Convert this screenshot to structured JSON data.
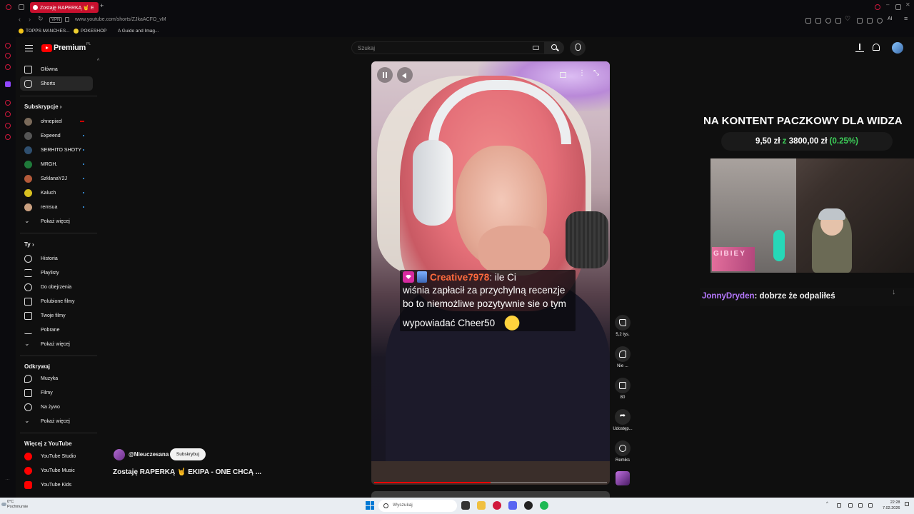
{
  "browser": {
    "tab_title": "Zostaję RAPERKĄ 🤘 E",
    "vpn_label": "VPN",
    "url": "www.youtube.com/shorts/ZJkaACFO_vM",
    "ai_label": "AI",
    "bookmarks": [
      {
        "label": "TOPPS MANCHES...",
        "color": "#f5c518"
      },
      {
        "label": "POKESHOP",
        "color": "#f0d030"
      },
      {
        "label": "A Guide and Imag...",
        "color": "#888888"
      }
    ]
  },
  "header": {
    "logo_text": "Premium",
    "logo_region": "PL",
    "search_placeholder": "Szukaj"
  },
  "nav": {
    "home": "Główna",
    "shorts": "Shorts",
    "subscriptions_title": "Subskrypcje",
    "subscriptions": [
      {
        "name": "ohnepixel",
        "color": "#7a6a5a",
        "status": "live"
      },
      {
        "name": "Expeend",
        "color": "#555555",
        "status": "new"
      },
      {
        "name": "SERHITO SHOTY",
        "color": "#2f4f6f",
        "status": "new"
      },
      {
        "name": "MRGH.",
        "color": "#1f7a3a",
        "status": "new"
      },
      {
        "name": "SzklanaY2J",
        "color": "#b35a3a",
        "status": "new"
      },
      {
        "name": "Kaluch",
        "color": "#d8c020",
        "status": "new"
      },
      {
        "name": "remsua",
        "color": "#caa080",
        "status": "new"
      }
    ],
    "show_more": "Pokaż więcej",
    "you_title": "Ty",
    "you_items": [
      "Historia",
      "Playlisty",
      "Do obejrzenia",
      "Polubione filmy",
      "Twoje filmy",
      "Pobrane",
      "Pokaż więcej"
    ],
    "explore_title": "Odkrywaj",
    "explore_items": [
      "Muzyka",
      "Filmy",
      "Na żywo",
      "Pokaż więcej"
    ],
    "more_title": "Więcej z YouTube",
    "more_items": [
      "YouTube Studio",
      "YouTube Music",
      "YouTube Kids"
    ]
  },
  "video": {
    "chat_user": "Creative7978",
    "chat_lines": [
      ": ile Ci",
      "wiśnia zapłacił za przychylną recenzje",
      "bo to niemożliwe pozytywnie sie o tym",
      "wypowiadać Cheer50"
    ],
    "progress": 0.5,
    "channel": "@Nieuczesana",
    "subscribe_label": "Subskrybuj",
    "title": "Zostaję RAPERKĄ 🤘 EKIPA - ONE CHCĄ ..."
  },
  "actions": {
    "likes": "5,2 tys.",
    "dislike": "Nie ...",
    "comments": "80",
    "share": "Udostęp...",
    "remix": "Remiks"
  },
  "stream_overlay": {
    "title": "NA KONTENT PACZKOWY DLA WIDZA",
    "goal_current": "9,50 zł",
    "goal_sep": "z",
    "goal_target": "3800,00 zł",
    "goal_percent": "(0.25%)",
    "neon_sign": "GIBIEY",
    "chat_user": "JonnyDryden",
    "chat_message": ": dobrze że odpaliłeś"
  },
  "taskbar": {
    "temp": "0°C",
    "weather": "Pochmurnie",
    "search": "Wyszukaj",
    "time": "22:28",
    "date": "7.02.2026"
  }
}
